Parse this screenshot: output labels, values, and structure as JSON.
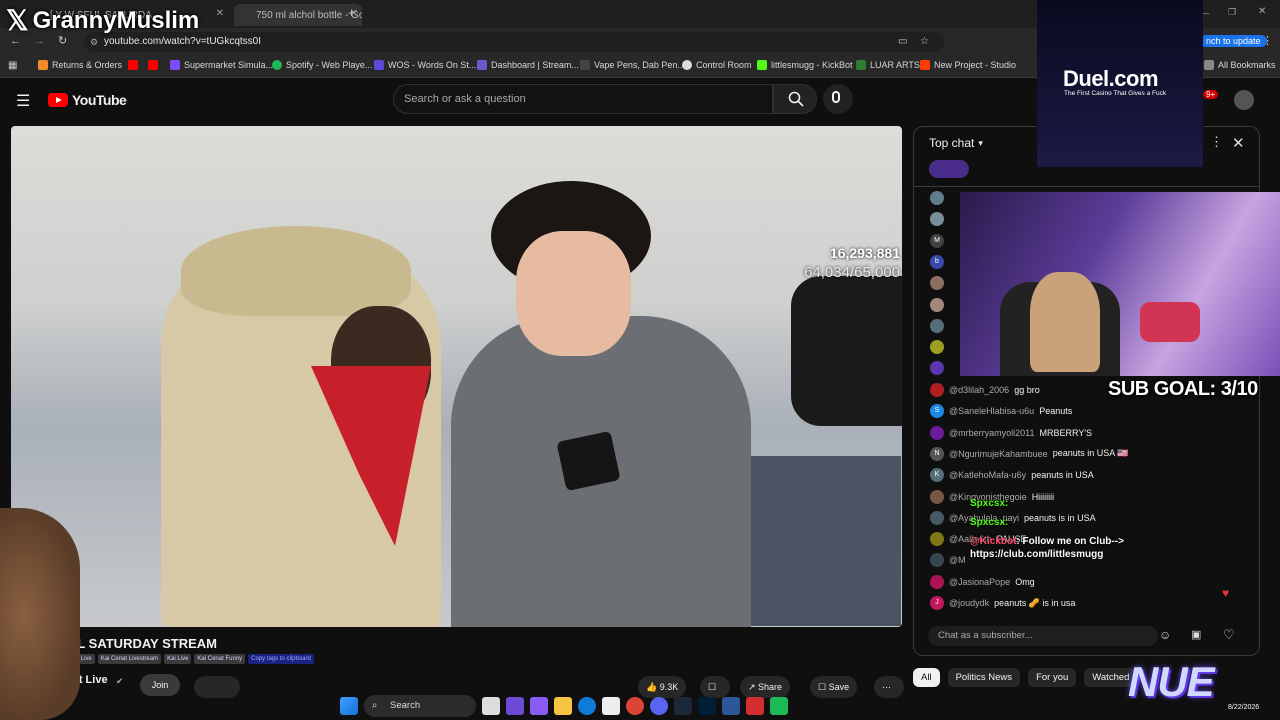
{
  "browser": {
    "tabs": [
      {
        "title": "[ Y W SFUL SATURDA"
      },
      {
        "title": "750 ml alchol bottle - Google"
      }
    ],
    "new_tab": "+",
    "url": "youtube.com/watch?v=tUGkcqtss0I",
    "relaunch_label": "nch to update",
    "bookmarks": [
      {
        "label": "Returns & Orders",
        "color": "#f28c28"
      },
      {
        "label": "",
        "color": "#ff0000"
      },
      {
        "label": "",
        "color": "#ff0000"
      },
      {
        "label": "Supermarket Simula...",
        "color": "#7c4dff"
      },
      {
        "label": "Spotify - Web Playe...",
        "color": "#1db954"
      },
      {
        "label": "WOS - Words On St...",
        "color": "#5b4bdb"
      },
      {
        "label": "Dashboard | Stream...",
        "color": "#6a5acd"
      },
      {
        "label": "Vape Pens, Dab Pen...",
        "color": "#444444"
      },
      {
        "label": "Control Room",
        "color": "#dddddd"
      },
      {
        "label": "littlesmugg - KickBot",
        "color": "#53fc18"
      },
      {
        "label": "LUAR ARTS",
        "color": "#2e7d32"
      },
      {
        "label": "New Project - Studio",
        "color": "#ff3d00"
      },
      {
        "label": "All Bookmarks",
        "color": "#888888"
      }
    ]
  },
  "youtube": {
    "logo_text": "YouTube",
    "search_placeholder": "Search or ask a question",
    "notif_count": "9+"
  },
  "video": {
    "view_count": "16,293,881",
    "sub_progress": "64,034/65,000",
    "title": "FUL SATURDAY STREAM",
    "tags": [
      "Cenat Live",
      "Kai Cenat Livestream",
      "Kai Live",
      "Kai Cenat Funny"
    ],
    "copy_tags": "Copy tags to clipboard",
    "channel": "nat Live",
    "join": "Join",
    "likes": "9.3K",
    "share": "Share",
    "save": "Save"
  },
  "chat": {
    "header": "Top chat",
    "input_placeholder": "Chat as a subscriber...",
    "messages": [
      {
        "user": "@d3lilah_2006",
        "msg": "gg bro",
        "avatar": "#b02020",
        "initial": ""
      },
      {
        "user": "@SaneleHlabisa-u6u",
        "msg": "Peanuts",
        "avatar": "#1e88e5",
        "initial": "S"
      },
      {
        "user": "@mrberryamyoli2011",
        "msg": "MRBERRY'S",
        "avatar": "#6a1b9a",
        "initial": ""
      },
      {
        "user": "@NgurimujeKahambuee",
        "msg": "peanuts in USA 🇺🇸",
        "avatar": "#555555",
        "initial": "N"
      },
      {
        "user": "@KatlehoMafa-u6y",
        "msg": "peanuts in USA",
        "avatar": "#546e7a",
        "initial": "K"
      },
      {
        "user": "@Kingvonisthegoie",
        "msg": "Hiiiiiiii",
        "avatar": "#795548",
        "initial": ""
      },
      {
        "user": "@Ayabulela_payi",
        "msg": "peanuts is in USA",
        "avatar": "#455a64",
        "initial": ""
      },
      {
        "user": "@Aalb-6th",
        "msg": "PAUSE",
        "avatar": "#827717",
        "initial": ""
      },
      {
        "user": "@M",
        "msg": "",
        "avatar": "#37474f",
        "initial": ""
      },
      {
        "user": "@JasionaPope",
        "msg": "Omg",
        "avatar": "#ad1457",
        "initial": ""
      },
      {
        "user": "@joudydk",
        "msg": "peanuts 🥜 is in usa",
        "avatar": "#c2185b",
        "initial": "J"
      }
    ],
    "top_avatars": [
      {
        "color": "#607d8b",
        "initial": ""
      },
      {
        "color": "#78909c",
        "initial": ""
      },
      {
        "color": "#424242",
        "initial": "M"
      },
      {
        "color": "#3949ab",
        "initial": "b"
      },
      {
        "color": "#8d6e63",
        "initial": ""
      },
      {
        "color": "#a1887f",
        "initial": ""
      },
      {
        "color": "#546e7a",
        "initial": ""
      },
      {
        "color": "#9e9d24",
        "initial": ""
      },
      {
        "color": "#5e35b1",
        "initial": ""
      }
    ],
    "filters": [
      "All",
      "Politics News",
      "For you",
      "Watched"
    ]
  },
  "overlay": {
    "watermark": "GrannyMuslim",
    "duel_title": "Duel.com",
    "duel_sub": "The First Casino That Gives a Fuck",
    "sub_goal": "SUB GOAL: 3/10",
    "kick_user1": "Spxcsx:",
    "kick_user2": "Spxcsx:",
    "kick_bot": "@Kickbot",
    "kick_msg": ": Follow me on Club-->",
    "kick_link": "https://club.com/littlesmugg",
    "nue": "NUE"
  },
  "taskbar": {
    "search": "Search",
    "date": "8/22/2026"
  }
}
